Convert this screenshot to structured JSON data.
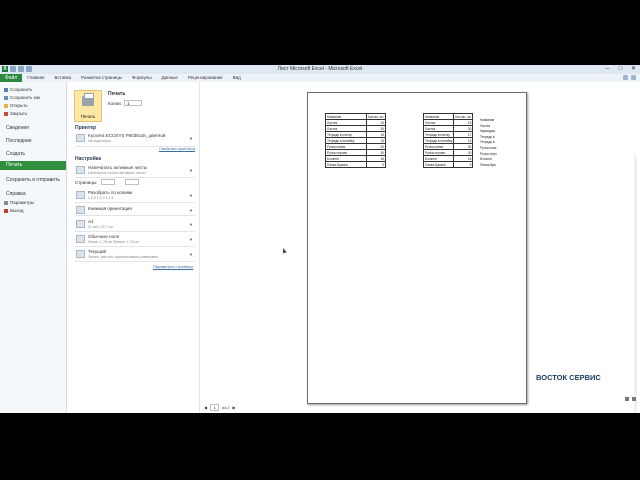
{
  "window": {
    "title": "Лист Microsoft Excel - Microsoft Excel",
    "controls": [
      "–",
      "□",
      "✕"
    ]
  },
  "ribbon": {
    "file_tab": "Файл",
    "tabs": [
      "Главная",
      "Вставка",
      "Разметка страницы",
      "Формулы",
      "Данные",
      "Рецензирование",
      "Вид"
    ]
  },
  "backstage_nav": {
    "top_items": [
      "Сохранить",
      "Сохранить как",
      "Открыть",
      "Закрыть"
    ],
    "sections": [
      "Сведения",
      "Последние",
      "Создать"
    ],
    "active": "Печать",
    "share": "Сохранить и отправить",
    "help": "Справка",
    "bottom_items": [
      "Параметры",
      "Выход"
    ]
  },
  "print_panel": {
    "title": "Печать",
    "print_button": "Печать",
    "copies_label": "Копии:",
    "copies_value": "1",
    "printer_title": "Принтер",
    "printer_name": "Kyocera ECOSYS P6035cdn_цветной",
    "printer_status": "Не подключен",
    "printer_props": "Свойства принтера",
    "settings_title": "Настройка",
    "active_sheets": "Напечатать активные листы",
    "active_sheets_sub": "Напечатать только активные листы",
    "pages_label": "Страницы:",
    "collate": "Разобрать по копиям",
    "collate_sub": "1,2,3   1,2,3   1,2,3",
    "orientation": "Книжная ориентация",
    "paper": "A4",
    "paper_sub": "21 см x 29,7 см",
    "margins": "Обычные поля",
    "margins_sub": "Левое: 1,78 см   Правое: 1,78 см",
    "scaling": "Текущий",
    "scaling_sub": "Печать листов с фактическими размерами",
    "page_setup": "Параметры страницы"
  },
  "pager": {
    "current": "1",
    "of_label": "из 2"
  },
  "sheet": {
    "header": [
      "Название",
      "Кол-во, шт"
    ],
    "rows": [
      [
        "Ластик",
        "15"
      ],
      [
        "Ластик",
        "30"
      ],
      [
        "Тетрадь в клетку",
        "15"
      ],
      [
        "Тетрадь в линейку",
        "15"
      ],
      [
        "Ручка синяя",
        "30"
      ],
      [
        "Ручка черная",
        "30"
      ],
      [
        "Блокнот",
        "16"
      ],
      [
        "Папка-Бумага",
        "9"
      ]
    ],
    "table2_header": [
      "Название",
      "Кол-во, шт"
    ],
    "table2_rows": [
      [
        "Ластик",
        "15"
      ],
      [
        "Ластик",
        "30"
      ],
      [
        "Тетрадь в клетку",
        "17"
      ],
      [
        "Тетрадь в линейку",
        "15"
      ],
      [
        "Ручка синяя",
        "30"
      ],
      [
        "Ручка черная",
        "30"
      ],
      [
        "Блокнот",
        "16"
      ],
      [
        "Папка-Бумага",
        "9"
      ]
    ],
    "column3": [
      "Название",
      "Ластик",
      "Карандаш",
      "Тетрадь в",
      "Тетрадь в",
      "Ручка синя",
      "Ручка черн",
      "Блокнот",
      "Папка-бум"
    ]
  },
  "watermark": "ВОСТОК СЕРВИС"
}
